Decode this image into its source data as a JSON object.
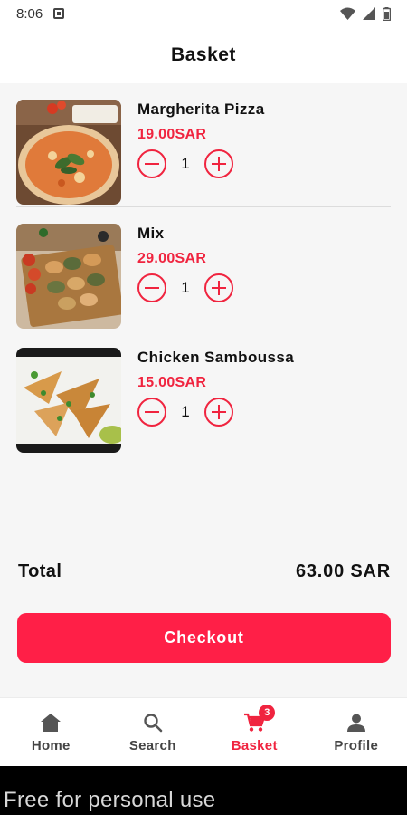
{
  "status_bar": {
    "time": "8:06"
  },
  "header": {
    "title": "Basket"
  },
  "items": [
    {
      "name": "Margherita Pizza",
      "price": "19.00SAR",
      "quantity": "1",
      "image": "pizza"
    },
    {
      "name": "Mix",
      "price": "29.00SAR",
      "quantity": "1",
      "image": "pastries"
    },
    {
      "name": "Chicken Samboussa",
      "price": "15.00SAR",
      "quantity": "1",
      "image": "samboussa"
    }
  ],
  "summary": {
    "total_label": "Total",
    "total_value": "63.00 SAR"
  },
  "checkout": {
    "label": "Checkout"
  },
  "nav": {
    "items": [
      {
        "label": "Home",
        "icon": "home-icon"
      },
      {
        "label": "Search",
        "icon": "search-icon"
      },
      {
        "label": "Basket",
        "icon": "cart-icon",
        "badge": "3",
        "active": true
      },
      {
        "label": "Profile",
        "icon": "person-icon"
      }
    ]
  },
  "watermark": {
    "text": "Free for personal use"
  },
  "colors": {
    "accent": "#f0243f",
    "button": "#ff1f47",
    "background": "#f6f6f6"
  }
}
